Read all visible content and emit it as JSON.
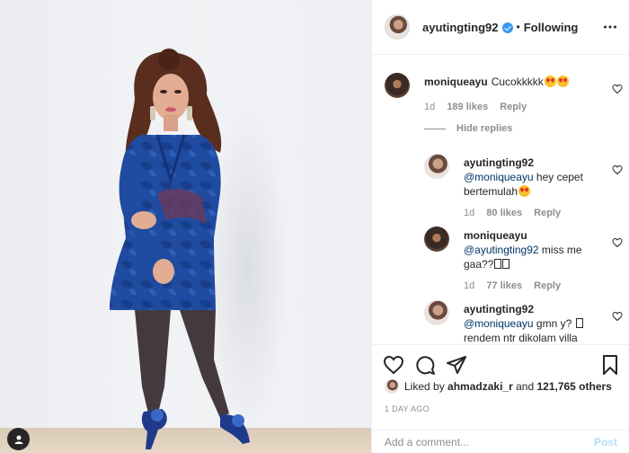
{
  "photo": {
    "alt_subject": "woman-in-blue-dress"
  },
  "header": {
    "username": "ayutingting92",
    "separator": "•",
    "follow_label": "Following",
    "verified": true
  },
  "comments": [
    {
      "author": "moniqueayu",
      "text": "Cucokkkkk",
      "time": "1d",
      "likes": "189 likes",
      "reply_label": "Reply"
    }
  ],
  "hide_replies_label": "Hide replies",
  "replies": [
    {
      "author": "ayutingting92",
      "mention": "@moniqueayu",
      "text": " hey cepet bertemulah",
      "time": "1d",
      "likes": "80 likes",
      "reply_label": "Reply"
    },
    {
      "author": "moniqueayu",
      "mention": "@ayutingting92",
      "text": " miss me gaa??",
      "time": "1d",
      "likes": "77 likes",
      "reply_label": "Reply"
    },
    {
      "author": "ayutingting92",
      "mention": "@moniqueayu",
      "text": " gmn y? ",
      "text2": " rendem ntr dikolam villa"
    }
  ],
  "actions": {
    "liked_by_prefix": "Liked by ",
    "liked_by_user": "ahmadzaki_r",
    "liked_by_mid": " and ",
    "liked_by_count": "121,765 others",
    "timestamp": "1 DAY AGO"
  },
  "add_comment": {
    "placeholder": "Add a comment...",
    "post_label": "Post"
  },
  "colors": {
    "accent_blue": "#3897f0",
    "mention_blue": "#003569",
    "muted": "#8e8e8e",
    "post_disabled": "#b2dffc"
  },
  "icons": [
    "heart-icon",
    "comment-icon",
    "share-icon",
    "bookmark-icon",
    "more-options-icon",
    "verified-badge-icon",
    "user-tag-icon"
  ]
}
